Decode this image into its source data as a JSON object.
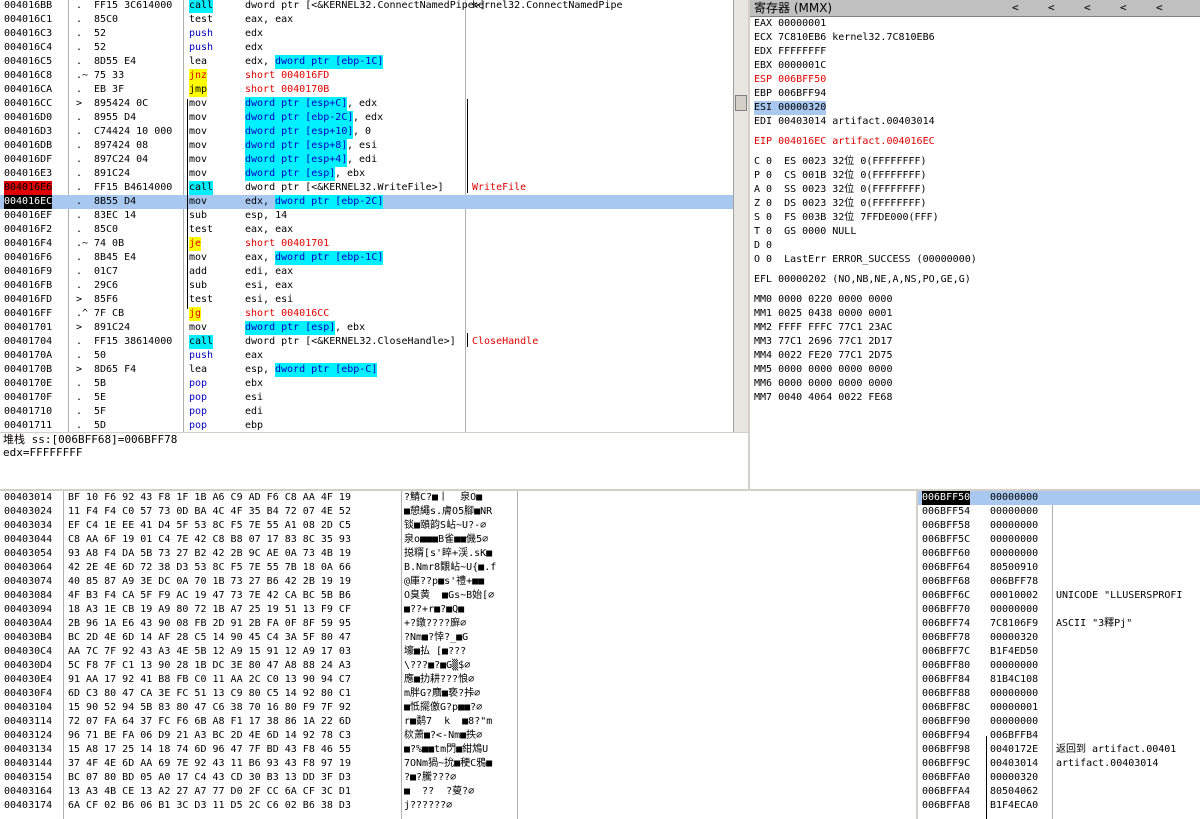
{
  "disasm": {
    "rows": [
      {
        "addr": "004016BB",
        "dot": ".",
        "bytes": "FF15 3C614000",
        "mn": "call",
        "mnhl": "hl-c",
        "op": "dword ptr [<&KERNEL32.ConnectNamedPipe>]",
        "cm": "kernel32.ConnectNamedPipe",
        "cmred": false
      },
      {
        "addr": "004016C1",
        "dot": ".",
        "bytes": "85C0",
        "mn": "test",
        "op": "eax, eax",
        "cm": ""
      },
      {
        "addr": "004016C3",
        "dot": ".",
        "bytes": "52",
        "mn": "push",
        "mnblue": true,
        "op": "edx",
        "cm": ""
      },
      {
        "addr": "004016C4",
        "dot": ".",
        "bytes": "52",
        "mn": "push",
        "mnblue": true,
        "op": "edx",
        "cm": ""
      },
      {
        "addr": "004016C5",
        "dot": ".",
        "bytes": "8D55 E4",
        "mn": "lea",
        "op": "edx, ",
        "ophl": "dword ptr [ebp-1C]",
        "cm": ""
      },
      {
        "addr": "004016C8",
        "dot": ".~",
        "bytes": "75 33",
        "mn": "jnz",
        "mnhl": "hl-y",
        "mnred": true,
        "op": "short 004016FD",
        "opred": true,
        "cm": ""
      },
      {
        "addr": "004016CA",
        "dot": ".",
        "bytes": "EB 3F",
        "mn": "jmp",
        "mnhl": "hl-y",
        "op": "short 0040170B",
        "opred": true,
        "cm": ""
      },
      {
        "addr": "004016CC",
        "dot": ">",
        "bytes": "895424 0C",
        "mn": "mov",
        "op": "",
        "ophl": "dword ptr [esp+C]",
        "op2": ", edx",
        "cm": ""
      },
      {
        "addr": "004016D0",
        "dot": ".",
        "bytes": "8955 D4",
        "mn": "mov",
        "op": "",
        "ophl": "dword ptr [ebp-2C]",
        "op2": ", edx",
        "cm": ""
      },
      {
        "addr": "004016D3",
        "dot": ".",
        "bytes": "C74424 10 000",
        "mn": "mov",
        "op": "",
        "ophl": "dword ptr [esp+10]",
        "op2": ", 0",
        "cm": ""
      },
      {
        "addr": "004016DB",
        "dot": ".",
        "bytes": "897424 08",
        "mn": "mov",
        "op": "",
        "ophl": "dword ptr [esp+8]",
        "op2": ", esi",
        "cm": ""
      },
      {
        "addr": "004016DF",
        "dot": ".",
        "bytes": "897C24 04",
        "mn": "mov",
        "op": "",
        "ophl": "dword ptr [esp+4]",
        "op2": ", edi",
        "cm": ""
      },
      {
        "addr": "004016E3",
        "dot": ".",
        "bytes": "891C24",
        "mn": "mov",
        "op": "",
        "ophl": "dword ptr [esp]",
        "op2": ", ebx",
        "cm": ""
      },
      {
        "addr": "004016E6",
        "dot": ".",
        "bytes": "FF15 B4614000",
        "mn": "call",
        "mnhl": "hl-c",
        "op": "dword ptr [<&KERNEL32.WriteFile>]",
        "cm": "WriteFile",
        "cmred": true,
        "rowcls": "row-bp"
      },
      {
        "addr": "004016EC",
        "dot": ".",
        "bytes": "8B55 D4",
        "mn": "mov",
        "op": "edx, ",
        "ophl": "dword ptr [ebp-2C]",
        "cm": "",
        "rowcls": "row-eip row-sel"
      },
      {
        "addr": "004016EF",
        "dot": ".",
        "bytes": "83EC 14",
        "mn": "sub",
        "op": "esp, 14",
        "cm": ""
      },
      {
        "addr": "004016F2",
        "dot": ".",
        "bytes": "85C0",
        "mn": "test",
        "op": "eax, eax",
        "cm": ""
      },
      {
        "addr": "004016F4",
        "dot": ".~",
        "bytes": "74 0B",
        "mn": "je",
        "mnhl": "hl-y",
        "mnred": true,
        "op": "short 00401701",
        "opred": true,
        "cm": ""
      },
      {
        "addr": "004016F6",
        "dot": ".",
        "bytes": "8B45 E4",
        "mn": "mov",
        "op": "eax, ",
        "ophl": "dword ptr [ebp-1C]",
        "cm": ""
      },
      {
        "addr": "004016F9",
        "dot": ".",
        "bytes": "01C7",
        "mn": "add",
        "op": "edi, eax",
        "cm": ""
      },
      {
        "addr": "004016FB",
        "dot": ".",
        "bytes": "29C6",
        "mn": "sub",
        "op": "esi, eax",
        "cm": ""
      },
      {
        "addr": "004016FD",
        "dot": ">",
        "bytes": "85F6",
        "mn": "test",
        "op": "esi, esi",
        "cm": ""
      },
      {
        "addr": "004016FF",
        "dot": ".^",
        "bytes": "7F CB",
        "mn": "jg",
        "mnhl": "hl-y",
        "mnred": true,
        "op": "short 004016CC",
        "opred": true,
        "cm": ""
      },
      {
        "addr": "00401701",
        "dot": ">",
        "bytes": "891C24",
        "mn": "mov",
        "op": "",
        "ophl": "dword ptr [esp]",
        "op2": ", ebx",
        "cm": ""
      },
      {
        "addr": "00401704",
        "dot": ".",
        "bytes": "FF15 38614000",
        "mn": "call",
        "mnhl": "hl-c",
        "op": "dword ptr [<&KERNEL32.CloseHandle>]",
        "cm": "CloseHandle",
        "cmred": true
      },
      {
        "addr": "0040170A",
        "dot": ".",
        "bytes": "50",
        "mn": "push",
        "mnblue": true,
        "op": "eax",
        "cm": ""
      },
      {
        "addr": "0040170B",
        "dot": ">",
        "bytes": "8D65 F4",
        "mn": "lea",
        "op": "esp, ",
        "ophl": "dword ptr [ebp-C]",
        "cm": ""
      },
      {
        "addr": "0040170E",
        "dot": ".",
        "bytes": "5B",
        "mn": "pop",
        "mnblue": true,
        "op": "ebx",
        "cm": ""
      },
      {
        "addr": "0040170F",
        "dot": ".",
        "bytes": "5E",
        "mn": "pop",
        "mnblue": true,
        "op": "esi",
        "cm": ""
      },
      {
        "addr": "00401710",
        "dot": ".",
        "bytes": "5F",
        "mn": "pop",
        "mnblue": true,
        "op": "edi",
        "cm": ""
      },
      {
        "addr": "00401711",
        "dot": ".",
        "bytes": "5D",
        "mn": "pop",
        "mnblue": true,
        "op": "ebp",
        "cm": ""
      }
    ]
  },
  "info": {
    "line1": "堆栈 ss:[006BFF68]=006BFF78",
    "line2": "edx=FFFFFFFF"
  },
  "registers": {
    "title": "寄存器 (MMX)",
    "arrows": [
      "<",
      "<",
      "<",
      "<",
      "<"
    ],
    "lines": [
      {
        "t": "EAX 00000001"
      },
      {
        "t": "ECX 7C810EB6 kernel32.7C810EB6"
      },
      {
        "t": "EDX FFFFFFFF"
      },
      {
        "t": "EBX 0000001C"
      },
      {
        "t": "ESP 006BFF50",
        "red": true
      },
      {
        "t": "EBP 006BFF94"
      },
      {
        "t": "ESI 00000320",
        "sel": true
      },
      {
        "t": "EDI 00403014 artifact.00403014"
      },
      {
        "t": ""
      },
      {
        "t": "EIP 004016EC artifact.004016EC",
        "red": true
      },
      {
        "t": ""
      },
      {
        "t": "C 0  ES 0023 32位 0(FFFFFFFF)"
      },
      {
        "t": "P 0  CS 001B 32位 0(FFFFFFFF)"
      },
      {
        "t": "A 0  SS 0023 32位 0(FFFFFFFF)"
      },
      {
        "t": "Z 0  DS 0023 32位 0(FFFFFFFF)"
      },
      {
        "t": "S 0  FS 003B 32位 7FFDE000(FFF)"
      },
      {
        "t": "T 0  GS 0000 NULL"
      },
      {
        "t": "D 0"
      },
      {
        "t": "O 0  LastErr ERROR_SUCCESS (00000000)"
      },
      {
        "t": ""
      },
      {
        "t": "EFL 00000202 (NO,NB,NE,A,NS,PO,GE,G)"
      },
      {
        "t": ""
      },
      {
        "t": "MM0 0000 0220 0000 0000"
      },
      {
        "t": "MM1 0025 0438 0000 0001"
      },
      {
        "t": "MM2 FFFF FFFC 77C1 23AC"
      },
      {
        "t": "MM3 77C1 2696 77C1 2D17"
      },
      {
        "t": "MM4 0022 FE20 77C1 2D75"
      },
      {
        "t": "MM5 0000 0000 0000 0000"
      },
      {
        "t": "MM6 0000 0000 0000 0000"
      },
      {
        "t": "MM7 0040 4064 0022 FE68"
      }
    ]
  },
  "dump": {
    "rows": [
      {
        "a": "00403014",
        "h": "BF 10 F6 92 43 F8 1F 1B A6 C9 AD F6 C8 AA 4F 19",
        "s": "?鯖C?■丨  泉O■"
      },
      {
        "a": "00403024",
        "h": "11 F4 F4 C0 57 73 0D BA 4C 4F 35 B4 72 07 4E 52",
        "s": "■憩繩s.膚O5腳■NR"
      },
      {
        "a": "00403034",
        "h": "EF C4 1E EE 41 D4 5F 53 8C F5 7E 55 A1 08 2D C5",
        "s": "锬■頤韵S岾~U?-∅"
      },
      {
        "a": "00403044",
        "h": "C8 AA 6F 19 01 C4 7E 42 C8 B8 07 17 83 8C 35 93",
        "s": "泉o■■■B雀■■僟5∅"
      },
      {
        "a": "00403054",
        "h": "93 A8 F4 DA 5B 73 27 B2 42 2B 9C AE 0A 73 4B 19",
        "s": "搃糈[s'睟+渓.sK■"
      },
      {
        "a": "00403064",
        "h": "42 2E 4E 6D 72 38 D3 53 8C F5 7E 55 7B 18 0A 66",
        "s": "B.Nmr8覵岾~U{■.f"
      },
      {
        "a": "00403074",
        "h": "40 85 87 A9 3E DC 0A 70 1B 73 27 B6 42 2B 19 19",
        "s": "@厙??p■s'禮+■■"
      },
      {
        "a": "00403084",
        "h": "4F B3 F4 CA 5F F9 AC 19 47 73 7E 42 CA BC 5B B6",
        "s": "O臭黄  ■Gs~B始[∅"
      },
      {
        "a": "00403094",
        "h": "18 A3 1E CB 19 A9 80 72 1B A7 25 19 51 13 F9 CF",
        "s": "■??+r■?■Q■"
      },
      {
        "a": "004030A4",
        "h": "2B 96 1A E6 43 90 08 FB 2D 91 2B FA 0F 8F 59 95",
        "s": "+?鐓????廯∅"
      },
      {
        "a": "004030B4",
        "h": "BC 2D 4E 6D 14 AF 28 C5 14 90 45 C4 3A 5F 80 47",
        "s": "?Nm■?悻?_■G"
      },
      {
        "a": "004030C4",
        "h": "AA 7C 7F 92 43 A3 4E 5B 12 A9 15 91 12 A9 17 03",
        "s": "壕■払 [■???"
      },
      {
        "a": "004030D4",
        "h": "5C F8 7F C1 13 90 28 1B DC 3E 80 47 A8 88 24 A3",
        "s": "\\???■?■G▒$∅"
      },
      {
        "a": "004030E4",
        "h": "91 AA 17 92 41 B8 FB C0 11 AA 2C C0 13 90 94 C7",
        "s": "應■扐耕???悢∅"
      },
      {
        "a": "004030F4",
        "h": "6D C3 80 47 CA 3E FC 51 13 C9 80 C5 14 92 80 C1",
        "s": "m胖G?麛■亵?挊∅"
      },
      {
        "a": "00403104",
        "h": "15 90 52 94 5B 83 80 47 C6 38 70 16 80 F9 7F 92",
        "s": "■怟擺儌G?p■■?∅"
      },
      {
        "a": "00403114",
        "h": "72 07 FA 64 37 FC F6 6B A8 F1 17 38 86 1A 22 6D",
        "s": "r■鹬7  k  ■8?\"m"
      },
      {
        "a": "00403124",
        "h": "96 71 BE FA 06 D9 21 A3 BC 2D 4E 6D 14 92 78 C3",
        "s": "栨萧■?<-Nm■抶∅"
      },
      {
        "a": "00403134",
        "h": "15 A8 17 25 14 18 74 6D 96 47 7F BD 43 F8 46 55",
        "s": "■?%■■tm閁■紺鴆U"
      },
      {
        "a": "00403144",
        "h": "37 4F 4E 6D AA 69 7E 92 43 11 B6 93 43 F8 97 19",
        "s": "7ONm猧~抁■稉C鴉■"
      },
      {
        "a": "00403154",
        "h": "BC 07 80 BD 05 A0 17 C4 43 CD 30 B3 13 DD 3F D3",
        "s": "?■?騰???∅"
      },
      {
        "a": "00403164",
        "h": "13 A3 4B CE 13 A2 27 A7 77 D0 2F CC 6A CF 3C D1",
        "s": "■  ??  ?蓃?∅"
      },
      {
        "a": "00403174",
        "h": "6A CF 02 B6 06 B1 3C D3 11 D5 2C C6 02 B6 38 D3",
        "s": "j??????∅"
      }
    ]
  },
  "stack": {
    "rows": [
      {
        "a": "006BFF50",
        "v": "00000000",
        "c": "",
        "sel": true
      },
      {
        "a": "006BFF54",
        "v": "00000000",
        "c": ""
      },
      {
        "a": "006BFF58",
        "v": "00000000",
        "c": ""
      },
      {
        "a": "006BFF5C",
        "v": "00000000",
        "c": ""
      },
      {
        "a": "006BFF60",
        "v": "00000000",
        "c": ""
      },
      {
        "a": "006BFF64",
        "v": "80500910",
        "c": ""
      },
      {
        "a": "006BFF68",
        "v": "006BFF78",
        "c": ""
      },
      {
        "a": "006BFF6C",
        "v": "00010002",
        "c": "UNICODE \"LLUSERSPROFI"
      },
      {
        "a": "006BFF70",
        "v": "00000000",
        "c": ""
      },
      {
        "a": "006BFF74",
        "v": "7C8106F9",
        "c": "ASCII \"3釋Pj\""
      },
      {
        "a": "006BFF78",
        "v": "00000320",
        "c": ""
      },
      {
        "a": "006BFF7C",
        "v": "B1F4ED50",
        "c": ""
      },
      {
        "a": "006BFF80",
        "v": "00000000",
        "c": ""
      },
      {
        "a": "006BFF84",
        "v": "81B4C108",
        "c": ""
      },
      {
        "a": "006BFF88",
        "v": "00000000",
        "c": ""
      },
      {
        "a": "006BFF8C",
        "v": "00000001",
        "c": ""
      },
      {
        "a": "006BFF90",
        "v": "00000000",
        "c": ""
      },
      {
        "a": "006BFF94",
        "v": "006BFFB4",
        "c": ""
      },
      {
        "a": "006BFF98",
        "v": "0040172E",
        "c": "返回到 artifact.00401"
      },
      {
        "a": "006BFF9C",
        "v": "00403014",
        "c": "artifact.00403014"
      },
      {
        "a": "006BFFA0",
        "v": "00000320",
        "c": ""
      },
      {
        "a": "006BFFA4",
        "v": "80504062",
        "c": ""
      },
      {
        "a": "006BFFA8",
        "v": "B1F4ECA0",
        "c": ""
      }
    ]
  }
}
